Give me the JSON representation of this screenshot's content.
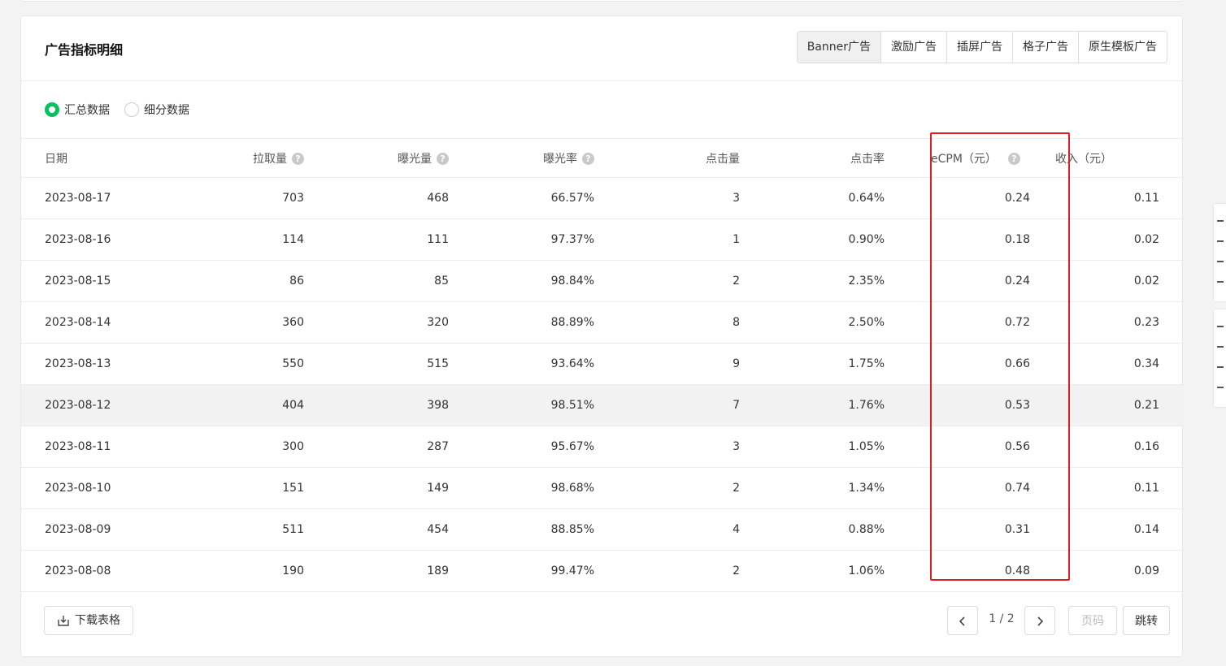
{
  "card": {
    "title": "广告指标明细",
    "ad_types": [
      "Banner广告",
      "激励广告",
      "插屏广告",
      "格子广告",
      "原生模板广告"
    ],
    "selected_ad_type": "Banner广告"
  },
  "radios": [
    {
      "label": "汇总数据",
      "checked": true
    },
    {
      "label": "细分数据",
      "checked": false
    }
  ],
  "table": {
    "headers": {
      "date": "日期",
      "requests": "拉取量",
      "impressions": "曝光量",
      "impression_rate": "曝光率",
      "clicks": "点击量",
      "ctr": "点击率",
      "ecpm": "eCPM（元）",
      "revenue": "收入（元）"
    },
    "rows": [
      {
        "date": "2023-08-17",
        "requests": "703",
        "impressions": "468",
        "impression_rate": "66.57%",
        "clicks": "3",
        "ctr": "0.64%",
        "ecpm": "0.24",
        "revenue": "0.11"
      },
      {
        "date": "2023-08-16",
        "requests": "114",
        "impressions": "111",
        "impression_rate": "97.37%",
        "clicks": "1",
        "ctr": "0.90%",
        "ecpm": "0.18",
        "revenue": "0.02"
      },
      {
        "date": "2023-08-15",
        "requests": "86",
        "impressions": "85",
        "impression_rate": "98.84%",
        "clicks": "2",
        "ctr": "2.35%",
        "ecpm": "0.24",
        "revenue": "0.02"
      },
      {
        "date": "2023-08-14",
        "requests": "360",
        "impressions": "320",
        "impression_rate": "88.89%",
        "clicks": "8",
        "ctr": "2.50%",
        "ecpm": "0.72",
        "revenue": "0.23"
      },
      {
        "date": "2023-08-13",
        "requests": "550",
        "impressions": "515",
        "impression_rate": "93.64%",
        "clicks": "9",
        "ctr": "1.75%",
        "ecpm": "0.66",
        "revenue": "0.34"
      },
      {
        "date": "2023-08-12",
        "requests": "404",
        "impressions": "398",
        "impression_rate": "98.51%",
        "clicks": "7",
        "ctr": "1.76%",
        "ecpm": "0.53",
        "revenue": "0.21"
      },
      {
        "date": "2023-08-11",
        "requests": "300",
        "impressions": "287",
        "impression_rate": "95.67%",
        "clicks": "3",
        "ctr": "1.05%",
        "ecpm": "0.56",
        "revenue": "0.16"
      },
      {
        "date": "2023-08-10",
        "requests": "151",
        "impressions": "149",
        "impression_rate": "98.68%",
        "clicks": "2",
        "ctr": "1.34%",
        "ecpm": "0.74",
        "revenue": "0.11"
      },
      {
        "date": "2023-08-09",
        "requests": "511",
        "impressions": "454",
        "impression_rate": "88.85%",
        "clicks": "4",
        "ctr": "0.88%",
        "ecpm": "0.31",
        "revenue": "0.14"
      },
      {
        "date": "2023-08-08",
        "requests": "190",
        "impressions": "189",
        "impression_rate": "99.47%",
        "clicks": "2",
        "ctr": "1.06%",
        "ecpm": "0.48",
        "revenue": "0.09"
      }
    ]
  },
  "footer": {
    "download_label": "下载表格",
    "page_indicator": "1 / 2",
    "page_input_placeholder": "页码",
    "jump_label": "跳转"
  },
  "colors": {
    "accent_green": "#07c160",
    "highlight_box": "#e02020"
  }
}
